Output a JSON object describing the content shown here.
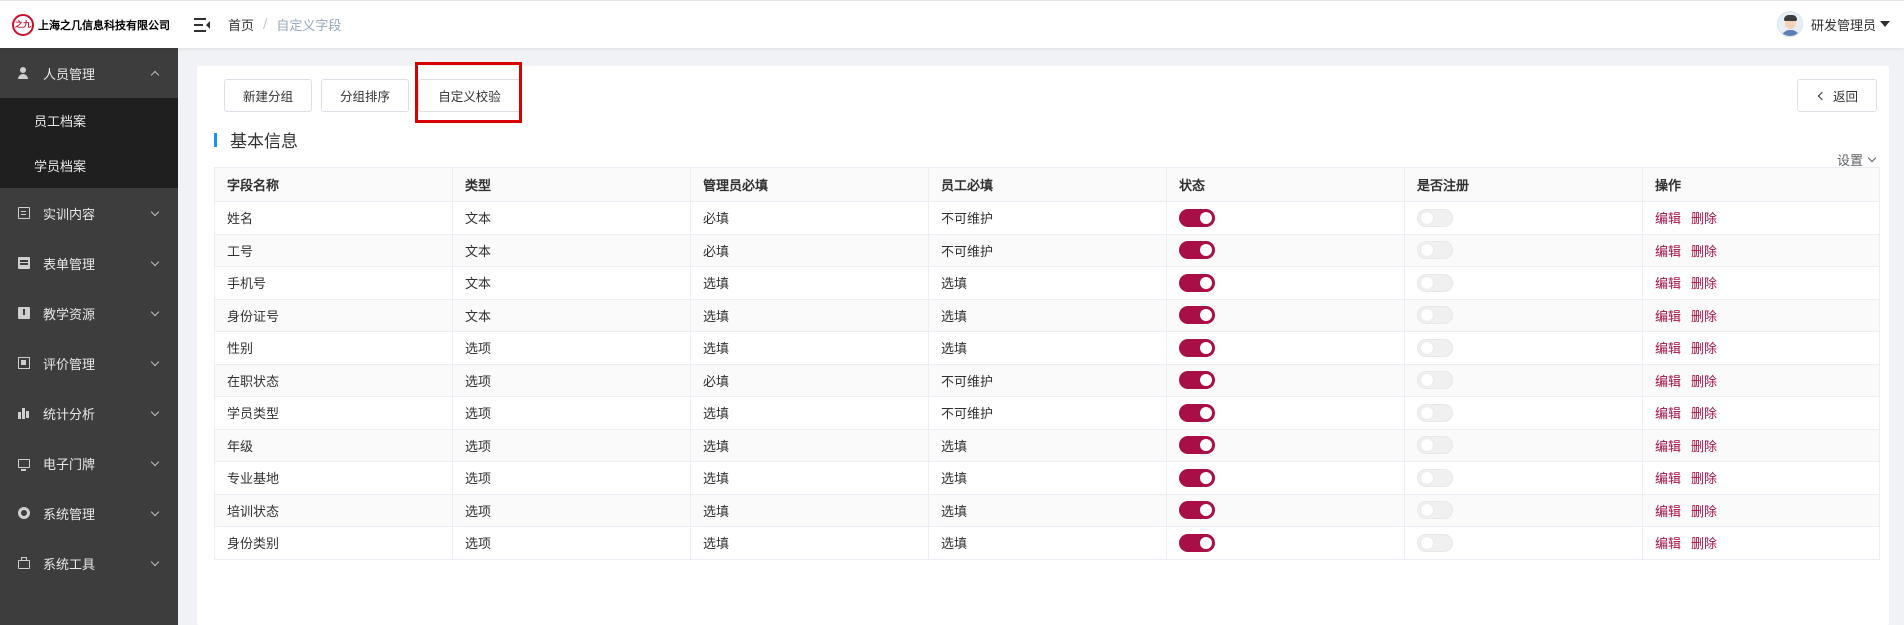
{
  "header": {
    "company_name": "上海之几信息科技有限公司",
    "logo_mark": "之九",
    "breadcrumb_home": "首页",
    "breadcrumb_separator": "/",
    "breadcrumb_current": "自定义字段",
    "user_name": "研发管理员"
  },
  "sidebar": {
    "items": [
      {
        "label": "人员管理",
        "icon": "person-icon",
        "expanded": true
      },
      {
        "label": "实训内容",
        "icon": "doc-icon"
      },
      {
        "label": "表单管理",
        "icon": "form-icon"
      },
      {
        "label": "教学资源",
        "icon": "book-icon"
      },
      {
        "label": "评价管理",
        "icon": "eval-icon"
      },
      {
        "label": "统计分析",
        "icon": "stats-icon"
      },
      {
        "label": "电子门牌",
        "icon": "screen-icon"
      },
      {
        "label": "系统管理",
        "icon": "gear-icon"
      },
      {
        "label": "系统工具",
        "icon": "toolbox-icon"
      }
    ],
    "submenu": [
      "员工档案",
      "学员档案"
    ]
  },
  "toolbar": {
    "new_group": "新建分组",
    "group_sort": "分组排序",
    "custom_validation": "自定义校验",
    "back": "返回"
  },
  "section": {
    "title": "基本信息",
    "settings": "设置"
  },
  "table": {
    "columns": [
      "字段名称",
      "类型",
      "管理员必填",
      "员工必填",
      "状态",
      "是否注册",
      "操作"
    ],
    "actions": {
      "edit": "编辑",
      "delete": "删除"
    },
    "rows": [
      {
        "name": "姓名",
        "type": "文本",
        "admin_required": "必填",
        "staff_required": "不可维护",
        "status_on": true,
        "register_on": false
      },
      {
        "name": "工号",
        "type": "文本",
        "admin_required": "必填",
        "staff_required": "不可维护",
        "status_on": true,
        "register_on": false
      },
      {
        "name": "手机号",
        "type": "文本",
        "admin_required": "选填",
        "staff_required": "选填",
        "status_on": true,
        "register_on": false
      },
      {
        "name": "身份证号",
        "type": "文本",
        "admin_required": "选填",
        "staff_required": "选填",
        "status_on": true,
        "register_on": false
      },
      {
        "name": "性别",
        "type": "选项",
        "admin_required": "选填",
        "staff_required": "选填",
        "status_on": true,
        "register_on": false
      },
      {
        "name": "在职状态",
        "type": "选项",
        "admin_required": "必填",
        "staff_required": "不可维护",
        "status_on": true,
        "register_on": false
      },
      {
        "name": "学员类型",
        "type": "选项",
        "admin_required": "选填",
        "staff_required": "不可维护",
        "status_on": true,
        "register_on": false
      },
      {
        "name": "年级",
        "type": "选项",
        "admin_required": "选填",
        "staff_required": "选填",
        "status_on": true,
        "register_on": false
      },
      {
        "name": "专业基地",
        "type": "选项",
        "admin_required": "选填",
        "staff_required": "选填",
        "status_on": true,
        "register_on": false
      },
      {
        "name": "培训状态",
        "type": "选项",
        "admin_required": "选填",
        "staff_required": "选填",
        "status_on": true,
        "register_on": false
      },
      {
        "name": "身份类别",
        "type": "选项",
        "admin_required": "选填",
        "staff_required": "选填",
        "status_on": true,
        "register_on": false
      }
    ]
  },
  "colors": {
    "accent": "#a80f47",
    "sidebar_bg": "#3d3d3d",
    "submenu_bg": "#1f1f1f",
    "section_bar": "#1890ff",
    "highlight": "#d90000"
  }
}
